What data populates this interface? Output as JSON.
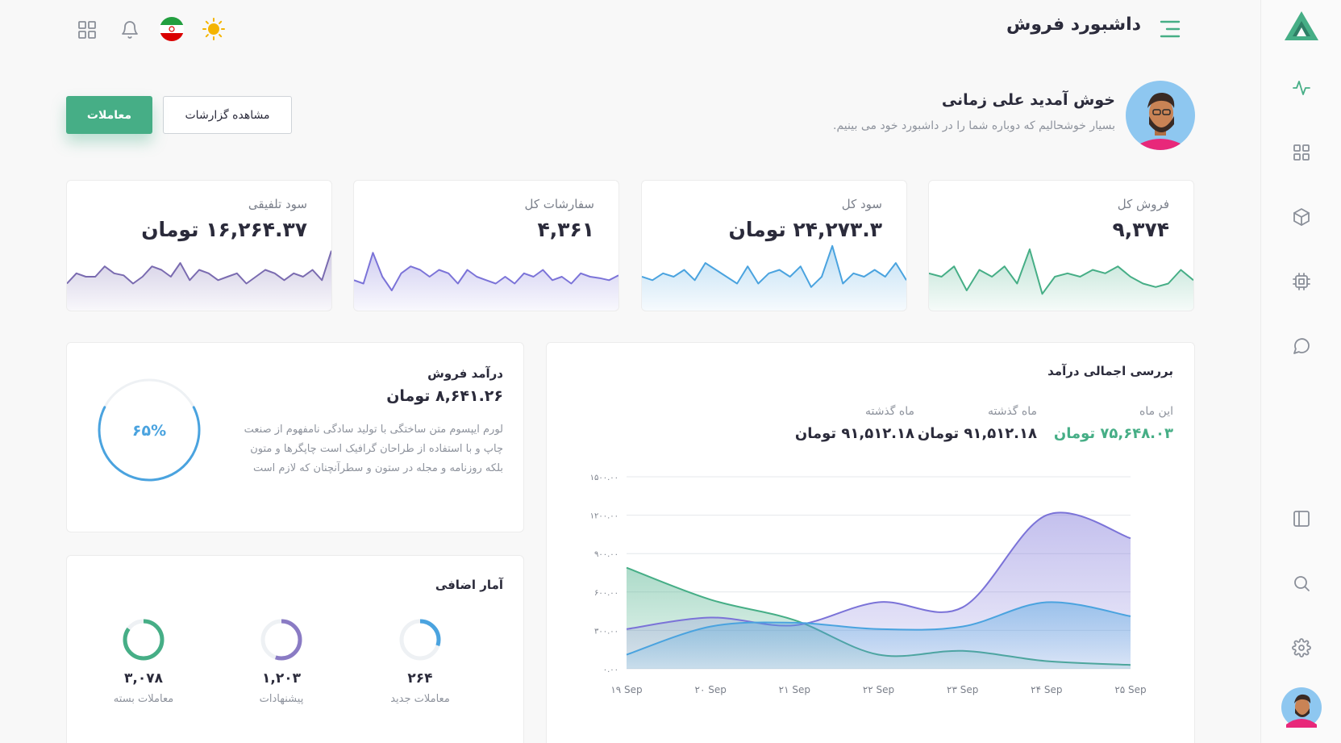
{
  "header": {
    "title": "داشبورد فروش",
    "icons": [
      "menu-icon",
      "sun-icon",
      "iran-flag-icon",
      "bell-icon",
      "grid-icon"
    ]
  },
  "welcome": {
    "heading": "خوش آمدید علی زمانی",
    "subtitle": "بسیار خوشحالیم که دوباره شما را در داشبورد خود می بینیم.",
    "reports_button": "مشاهده گزارشات",
    "transactions_button": "معاملات"
  },
  "stats": [
    {
      "label": "فروش کل",
      "value": "۹,۳۷۴",
      "color": "#46ae86",
      "spark": [
        45,
        40,
        55,
        20,
        50,
        40,
        55,
        30,
        80,
        15,
        40,
        45,
        40,
        50,
        45,
        55,
        40,
        30,
        25,
        30,
        50,
        35
      ]
    },
    {
      "label": "سود کل",
      "value": "۲۴,۲۷۳.۳ تومان",
      "color": "#4aa3df",
      "spark": [
        40,
        35,
        45,
        40,
        50,
        35,
        60,
        50,
        40,
        30,
        55,
        30,
        45,
        50,
        40,
        55,
        25,
        40,
        85,
        30,
        45,
        40,
        50,
        40,
        60,
        35
      ]
    },
    {
      "label": "سفارشات کل",
      "value": "۴,۳۶۱",
      "color": "#7b73d8",
      "spark": [
        35,
        30,
        75,
        40,
        20,
        45,
        55,
        50,
        40,
        50,
        45,
        30,
        50,
        40,
        35,
        30,
        40,
        30,
        45,
        40,
        50,
        35,
        40,
        30,
        45,
        40,
        38,
        35,
        42
      ]
    },
    {
      "label": "سود تلفیقی",
      "value": "۱۶,۲۶۴.۳۷ تومان",
      "color": "#7a6bb0",
      "spark": [
        30,
        45,
        40,
        40,
        55,
        45,
        42,
        30,
        40,
        55,
        50,
        40,
        60,
        35,
        50,
        45,
        35,
        40,
        45,
        30,
        40,
        50,
        45,
        35,
        45,
        40,
        50,
        35,
        78
      ]
    }
  ],
  "revenue_overview": {
    "title": "بررسی اجمالی درآمد",
    "this_month_label": "این ماه",
    "this_month_value": "۷۵,۶۴۸.۰۳ تومان",
    "last_month_label": "ماه گذشته",
    "last_month_value": "۹۱,۵۱۲.۱۸ تومان",
    "last_month_label_2": "ماه گذشته",
    "last_month_value_2": "۹۱,۵۱۲.۱۸ تومان",
    "colors": {
      "this_month": "#46ae86",
      "purple": "#7b73d8",
      "blue": "#4aa3df",
      "green": "#46ae86"
    }
  },
  "chart_data": {
    "type": "area",
    "x": [
      "۱۹ Sep",
      "۲۰ Sep",
      "۲۱ Sep",
      "۲۲ Sep",
      "۲۳ Sep",
      "۲۴ Sep",
      "۲۵ Sep"
    ],
    "y_ticks": [
      "۰.۰۰",
      "۳۰۰.۰۰",
      "۶۰۰.۰۰",
      "۹۰۰.۰۰",
      "۱۲۰۰.۰۰",
      "۱۵۰۰.۰۰"
    ],
    "ylim": [
      0,
      1500
    ],
    "series": [
      {
        "values": [
          310,
          400,
          340,
          520,
          480,
          1200,
          1020
        ]
      },
      {
        "values": [
          110,
          330,
          360,
          310,
          330,
          520,
          410
        ]
      },
      {
        "values": [
          790,
          540,
          380,
          110,
          140,
          60,
          30
        ]
      }
    ]
  },
  "sales_revenue": {
    "title": "درآمد فروش",
    "value": "۸,۶۴۱.۲۶ تومان",
    "description": "لورم ایپسوم متن ساختگی با تولید سادگی نامفهوم از صنعت چاپ و با استفاده از طراحان گرافیک است چاپگرها و متون بلکه روزنامه و مجله در ستون و سطرآنچنان که لازم است",
    "progress_text": "۶۵%",
    "progress": 0.65,
    "color": "#4aa3df"
  },
  "extra_stats": {
    "title": "آمار اضافی",
    "items": [
      {
        "value": "۲۶۴",
        "label": "معاملات جدید",
        "color": "#4aa3df",
        "progress": 0.3
      },
      {
        "value": "۱,۲۰۳",
        "label": "پیشنهادات",
        "color": "#8a7bc4",
        "progress": 0.55
      },
      {
        "value": "۳,۰۷۸",
        "label": "معاملات بسته",
        "color": "#46ae86",
        "progress": 0.85
      }
    ]
  },
  "sidebar": {
    "icons": [
      "logo-icon",
      "activity-icon",
      "grid-icon",
      "box-icon",
      "cpu-icon",
      "chat-icon",
      "layout-icon",
      "search-icon",
      "settings-icon",
      "avatar"
    ]
  }
}
